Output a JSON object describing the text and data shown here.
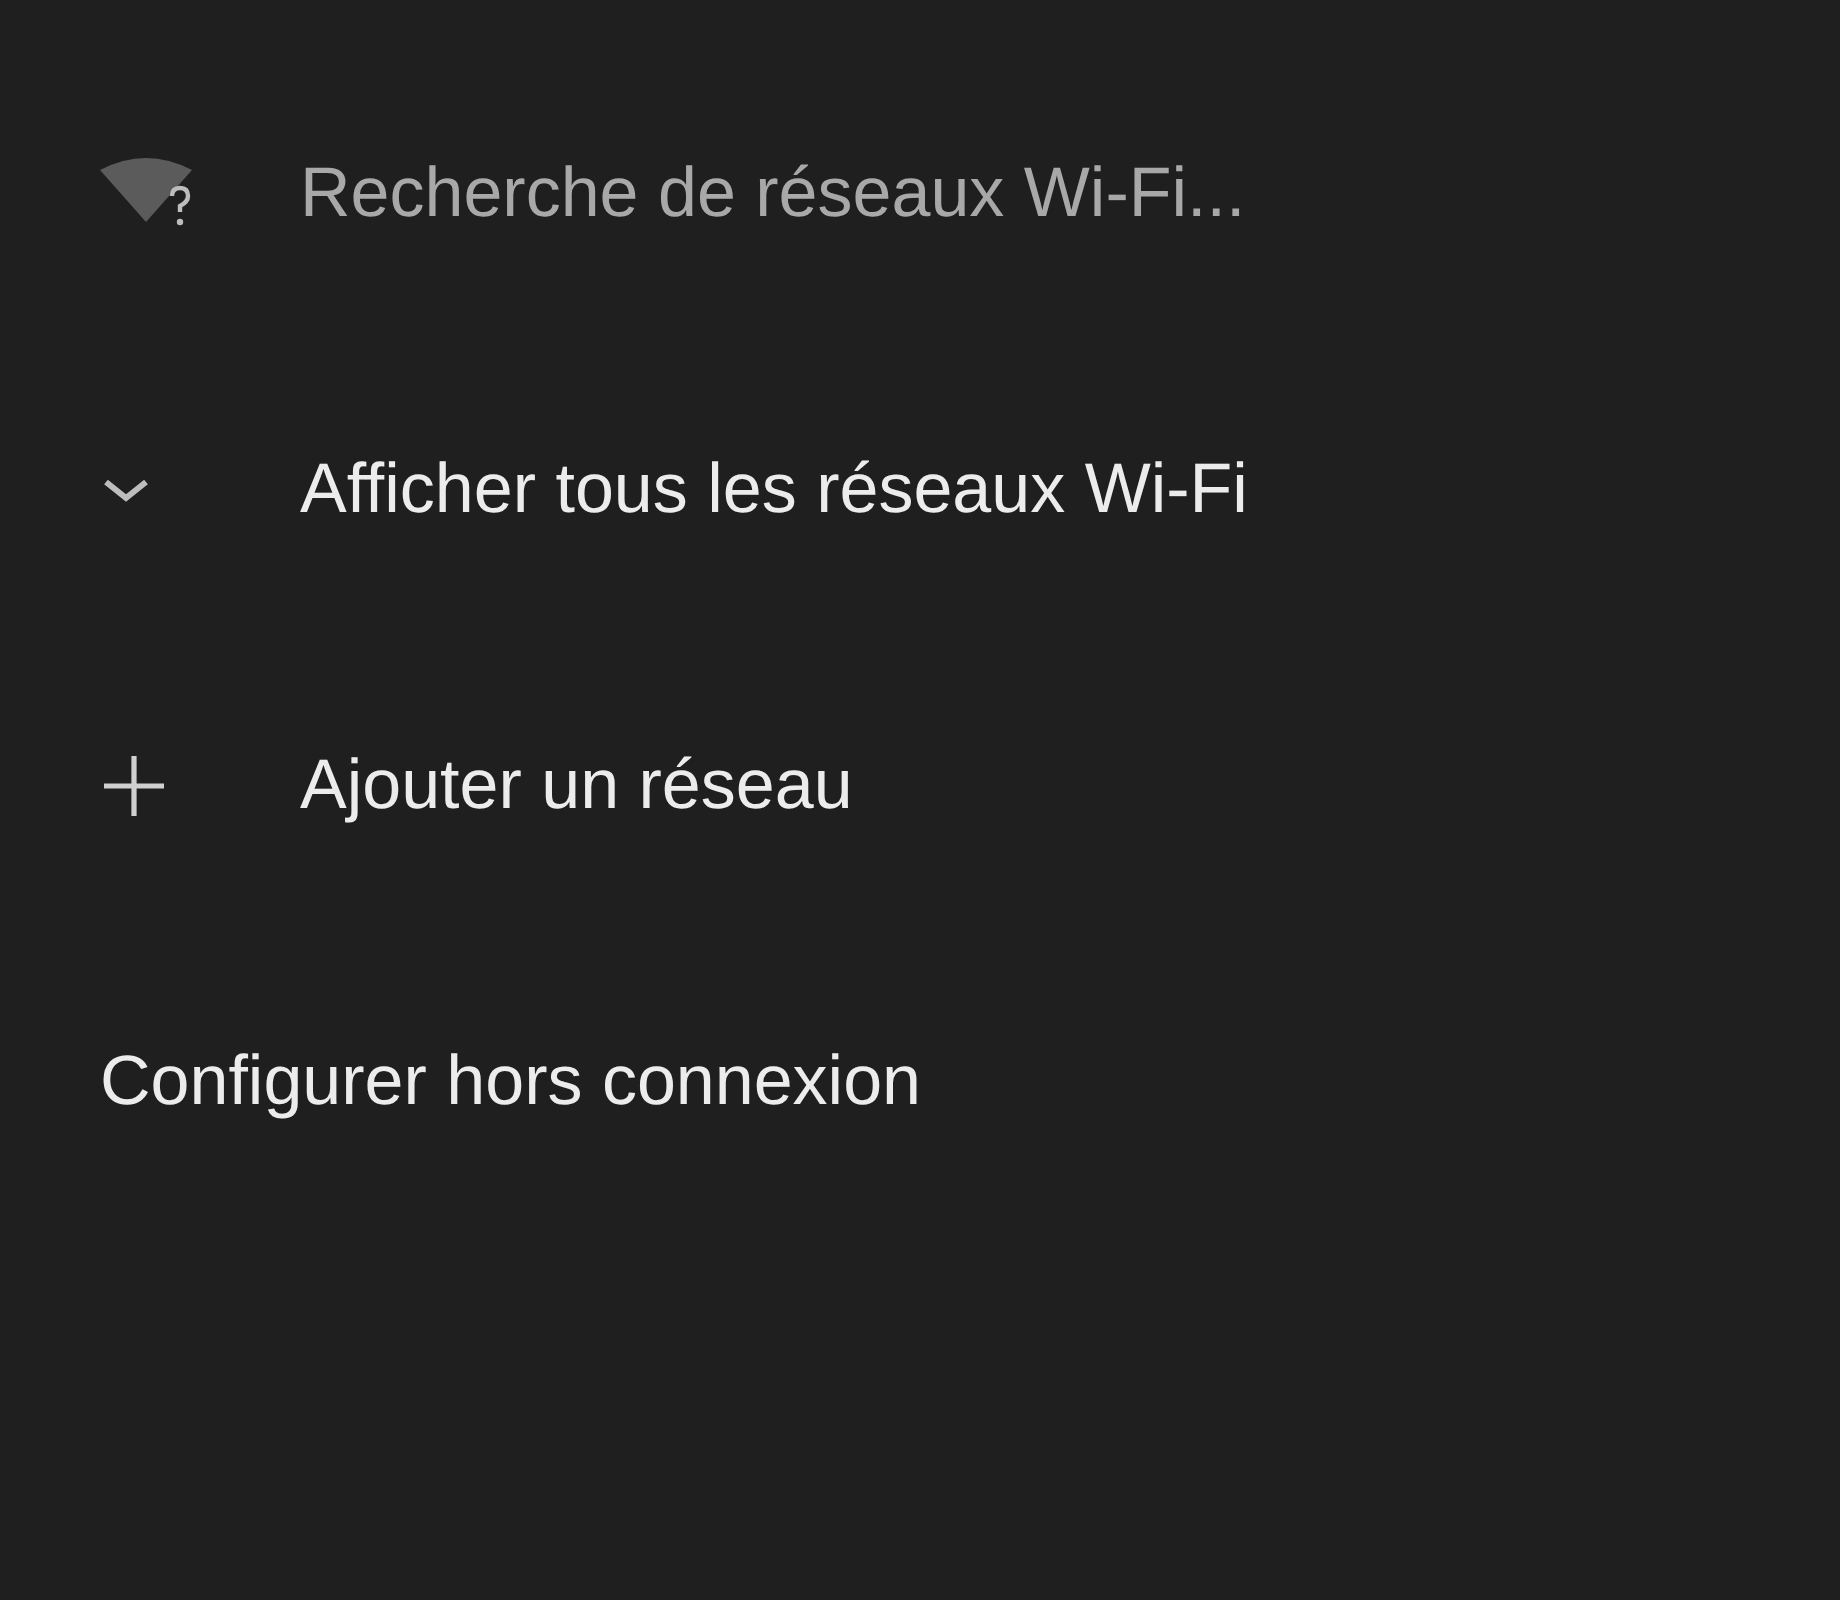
{
  "items": [
    {
      "kind": "status",
      "label": "Recherche de réseaux Wi-Fi...",
      "dimmed": true
    },
    {
      "kind": "expand",
      "label": "Afficher tous les réseaux Wi-Fi",
      "dimmed": false
    },
    {
      "kind": "add",
      "label": "Ajouter un réseau",
      "dimmed": false
    },
    {
      "kind": "plain",
      "label": "Configurer hors connexion",
      "dimmed": false
    }
  ]
}
